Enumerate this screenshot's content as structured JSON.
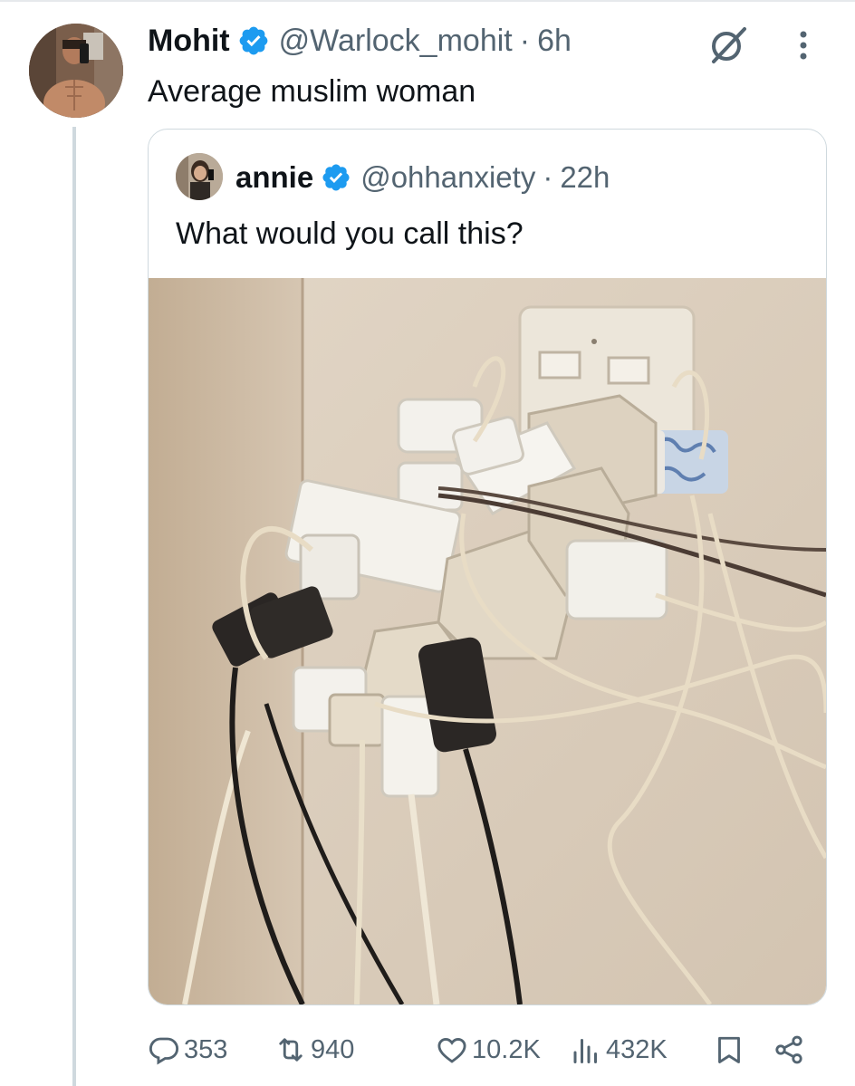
{
  "tweet": {
    "author_name": "Mohit",
    "handle": "@Warlock_mohit",
    "separator": "·",
    "time": "6h",
    "text": "Average muslim woman"
  },
  "quoted_tweet": {
    "author_name": "annie",
    "handle": "@ohhanxiety",
    "separator": "·",
    "time": "22h",
    "text": "What would you call this?"
  },
  "actions": {
    "replies": "353",
    "reposts": "940",
    "likes": "10.2K",
    "views": "432K"
  },
  "colors": {
    "verified": "#1d9bf0",
    "secondary_text": "#536471",
    "border": "#cfd9de"
  },
  "icons": [
    "grok-icon",
    "more-icon",
    "verified-icon",
    "reply-icon",
    "repost-icon",
    "like-icon",
    "views-icon",
    "bookmark-icon",
    "share-icon"
  ]
}
